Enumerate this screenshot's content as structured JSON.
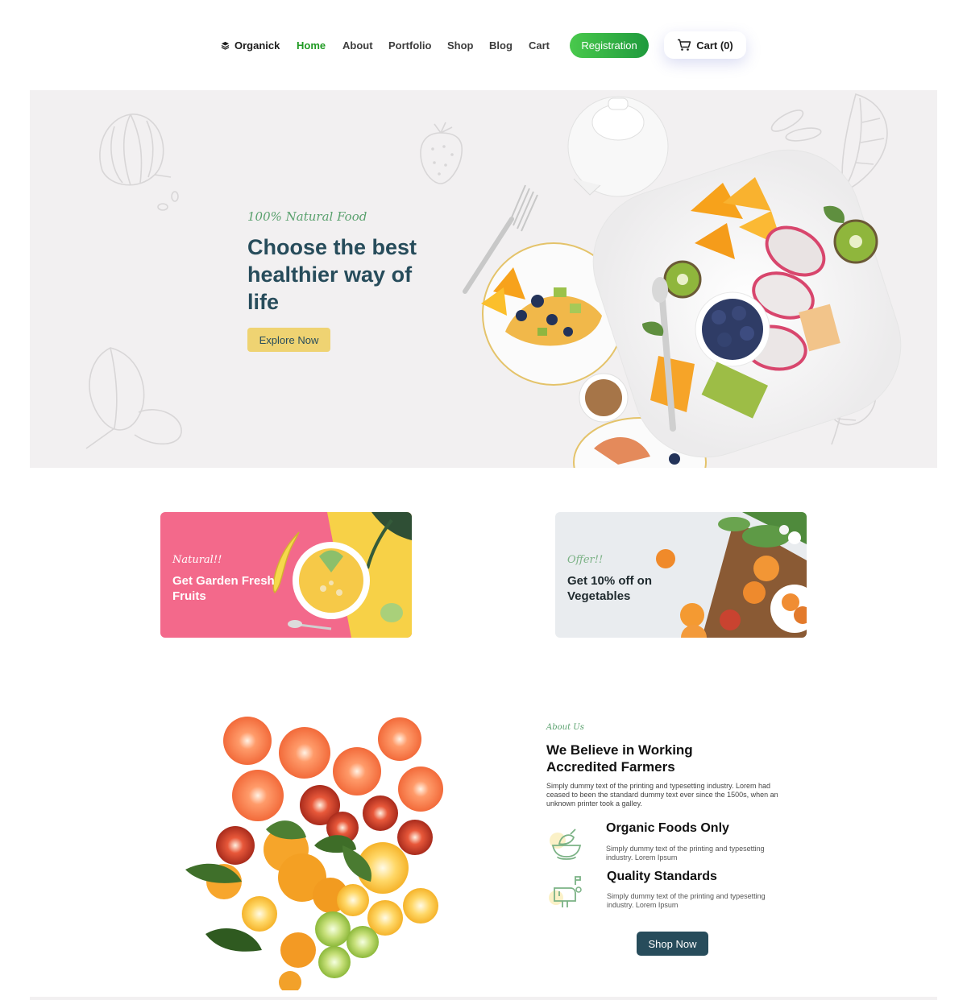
{
  "nav": {
    "brand": "Organick",
    "links": [
      "Home",
      "About",
      "Portfolio",
      "Shop",
      "Blog",
      "Cart"
    ],
    "active": "Home",
    "registration_label": "Registration",
    "cart_label": "Cart (0)",
    "accent_color": "#1f9a22"
  },
  "hero": {
    "tag": "100% Natural Food",
    "title": "Choose the best healthier way of life",
    "button_label": "Explore Now",
    "background": "#f2f0f1"
  },
  "promos": [
    {
      "tag": "Natural!!",
      "title": "Get Garden Fresh Fruits",
      "background": "#f3698b"
    },
    {
      "tag": "Offer!!",
      "title": "Get 10% off on Vegetables",
      "background": "#e9ecef"
    }
  ],
  "about": {
    "tag": "About Us",
    "title": "We Believe in Working Accredited Farmers",
    "description": "Simply dummy text of the printing and typesetting industry. Lorem had ceased to been the standard dummy text ever since the 1500s, when an unknown printer took a galley.",
    "features": [
      {
        "icon": "bowl-icon",
        "title": "Organic Foods Only",
        "description": "Simply dummy text of the printing and typesetting industry. Lorem Ipsum"
      },
      {
        "icon": "mailbox-icon",
        "title": "Quality Standards",
        "description": "Simply dummy text of the printing and typesetting industry. Lorem Ipsum"
      }
    ],
    "button_label": "Shop Now",
    "button_color": "#274c5b"
  }
}
